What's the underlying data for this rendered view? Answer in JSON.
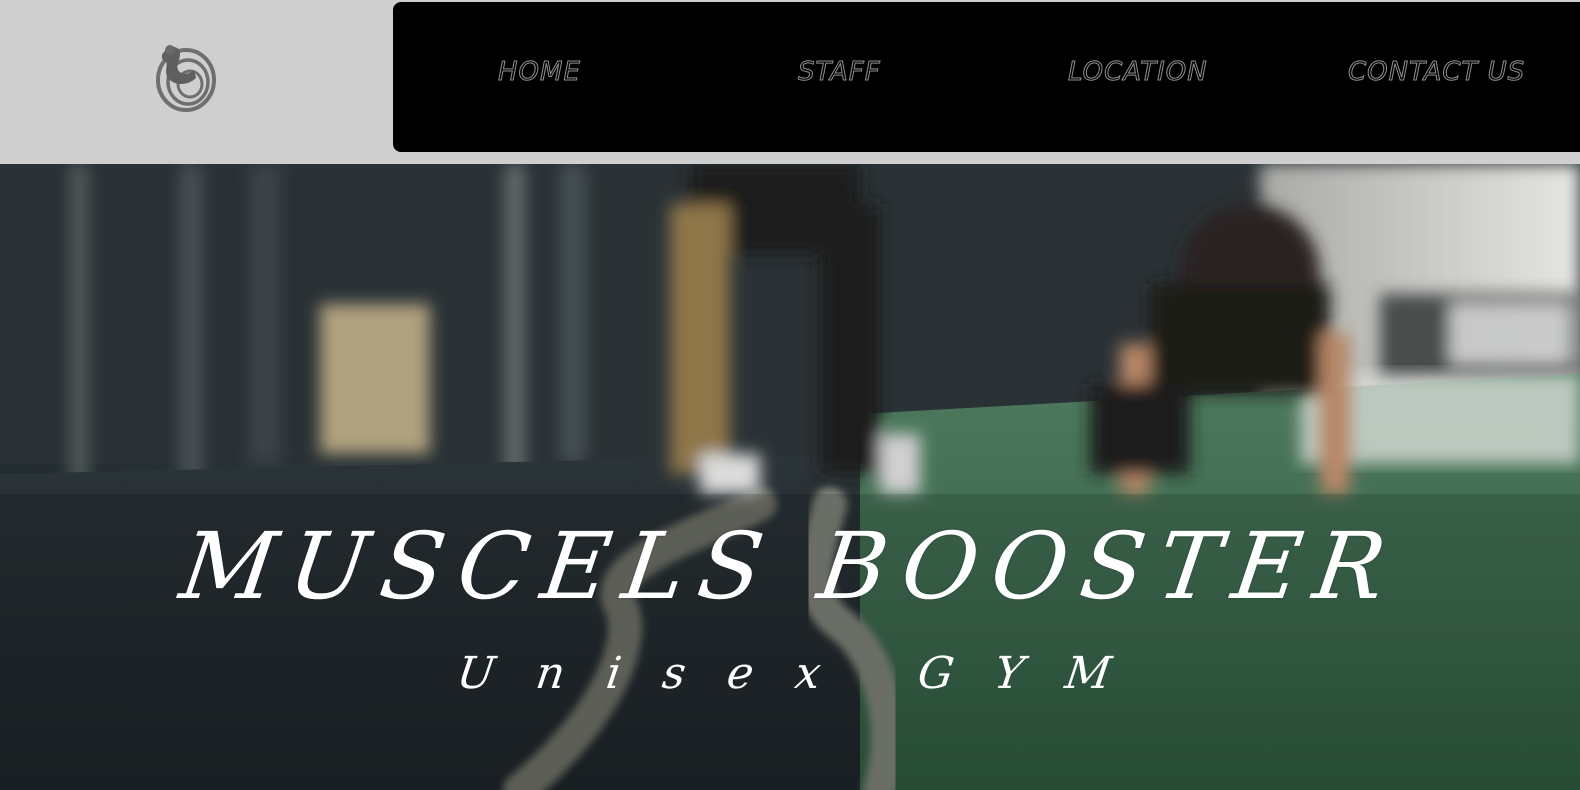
{
  "logo": {
    "icon": "flexing-arm-spiral-icon"
  },
  "nav": {
    "items": [
      {
        "label": "HOME"
      },
      {
        "label": "STAFF"
      },
      {
        "label": "LOCATION"
      },
      {
        "label": "CONTACT US"
      }
    ]
  },
  "hero": {
    "title": "MUSCELS BOOSTER",
    "subtitle": "Unisex GYM"
  },
  "colors": {
    "header_bg": "#cfcfcf",
    "nav_bg": "#000000",
    "nav_text": "#8f8f8f",
    "hero_text": "#ffffff"
  }
}
